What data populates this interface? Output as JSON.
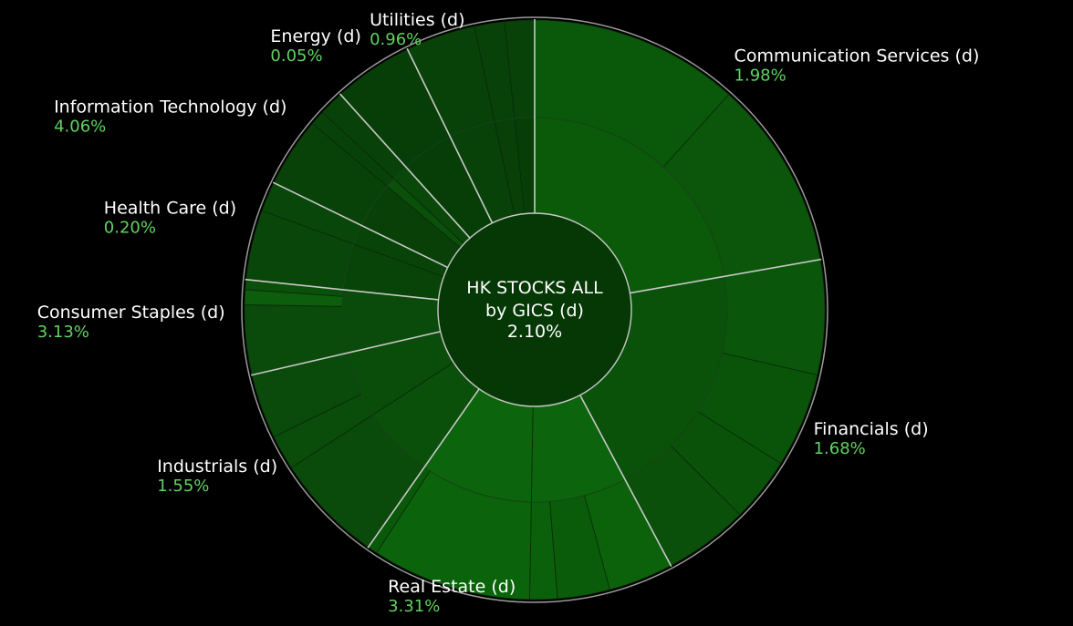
{
  "chart_data": {
    "type": "sunburst",
    "center": {
      "line1": "HK STOCKS ALL",
      "line2": "by GICS (d)",
      "value": "2.10%"
    },
    "unit": "%",
    "colors": {
      "background": "#000000",
      "positive": "#5fd35f",
      "divider": "#c8c8c8"
    },
    "sectors": [
      {
        "name": "Communication Services (d)",
        "value_label": "1.98%",
        "change": 1.98,
        "angle_span": [
          0,
          80
        ],
        "industries": [
          [
            0,
            80
          ]
        ],
        "sub_industries": [
          [
            0,
            42
          ],
          [
            42,
            80
          ]
        ],
        "fills": [
          "#0a5a0a",
          "#0a580a",
          "#0b560b"
        ]
      },
      {
        "name": "Financials (d)",
        "value_label": "1.68%",
        "change": 1.68,
        "angle_span": [
          80,
          152
        ],
        "industries": [
          [
            80,
            152
          ]
        ],
        "sub_industries": [
          [
            80,
            103
          ],
          [
            103,
            122
          ],
          [
            122,
            135
          ],
          [
            135,
            152
          ]
        ],
        "fills": [
          "#0a520a",
          "#0a560a",
          "#0a540a",
          "#0a520a",
          "#0a500a",
          "#0a500a"
        ]
      },
      {
        "name": "Real Estate (d)",
        "value_label": "3.31%",
        "change": 3.31,
        "angle_span": [
          152,
          215
        ],
        "industries": [
          [
            152,
            181
          ],
          [
            181,
            215
          ]
        ],
        "sub_industries": [
          [
            152,
            165
          ],
          [
            165,
            175.5
          ],
          [
            175.5,
            181
          ],
          [
            181,
            213
          ],
          [
            213,
            215
          ]
        ],
        "fills": [
          "#0c650c",
          "#0c640c",
          "#0b620b",
          "#0a5c0a",
          "#0b610b",
          "#0b640b",
          "#0a580a"
        ]
      },
      {
        "name": "Industrials (d)",
        "value_label": "1.55%",
        "change": 1.55,
        "angle_span": [
          215,
          257
        ],
        "industries": [
          [
            215,
            237
          ],
          [
            237,
            257
          ]
        ],
        "sub_industries": [
          [
            215,
            237
          ],
          [
            237,
            244
          ],
          [
            244,
            257
          ]
        ],
        "fills": [
          "#0a4f0a",
          "#0a4c0a",
          "#0a4a0a",
          "#0a4d0a",
          "#0a4a0a"
        ]
      },
      {
        "name": "Consumer Staples (d)",
        "value_label": "3.13%",
        "change": 3.13,
        "angle_span": [
          257,
          276
        ],
        "industries": [
          [
            257,
            276
          ]
        ],
        "sub_industries": [
          [
            257,
            271
          ],
          [
            271,
            274
          ],
          [
            274,
            276
          ]
        ],
        "fills": [
          "#0a4a0a",
          "#0a4a0a",
          "#0c5e0c",
          "#0a4f0a"
        ]
      },
      {
        "name": "Health Care (d)",
        "value_label": "0.20%",
        "change": 0.2,
        "angle_span": [
          276,
          296
        ],
        "industries": [
          [
            276,
            290
          ],
          [
            290,
            296
          ]
        ],
        "sub_industries": [
          [
            276,
            290
          ],
          [
            290,
            296
          ]
        ],
        "fills": [
          "#084408",
          "#084408",
          "#094609",
          "#094609"
        ]
      },
      {
        "name": "Information Technology (d)",
        "value_label": "4.06%",
        "change": 4.06,
        "angle_span": [
          296,
          318
        ],
        "industries": [
          [
            296,
            310
          ],
          [
            310,
            313
          ],
          [
            313,
            318
          ]
        ],
        "sub_industries": [
          [
            296,
            310
          ],
          [
            310,
            313
          ],
          [
            313,
            318
          ]
        ],
        "fills": [
          "#084008",
          "#0a500a",
          "#094809",
          "#084208"
        ]
      },
      {
        "name": "Energy (d)",
        "value_label": "0.05%",
        "change": 0.05,
        "angle_span": [
          318,
          334
        ],
        "industries": [
          [
            318,
            334
          ]
        ],
        "sub_industries": [
          [
            318,
            334
          ]
        ],
        "fills": [
          "#073e07",
          "#073e07"
        ]
      },
      {
        "name": "Utilities (d)",
        "value_label": "0.96%",
        "change": 0.96,
        "angle_span": [
          334,
          360
        ],
        "industries": [
          [
            334,
            348
          ],
          [
            348,
            354
          ],
          [
            354,
            360
          ]
        ],
        "sub_industries": [
          [
            334,
            348
          ],
          [
            348,
            354
          ],
          [
            354,
            360
          ]
        ],
        "fills": [
          "#084208",
          "#084008",
          "#073e07",
          "#084208"
        ]
      }
    ]
  }
}
